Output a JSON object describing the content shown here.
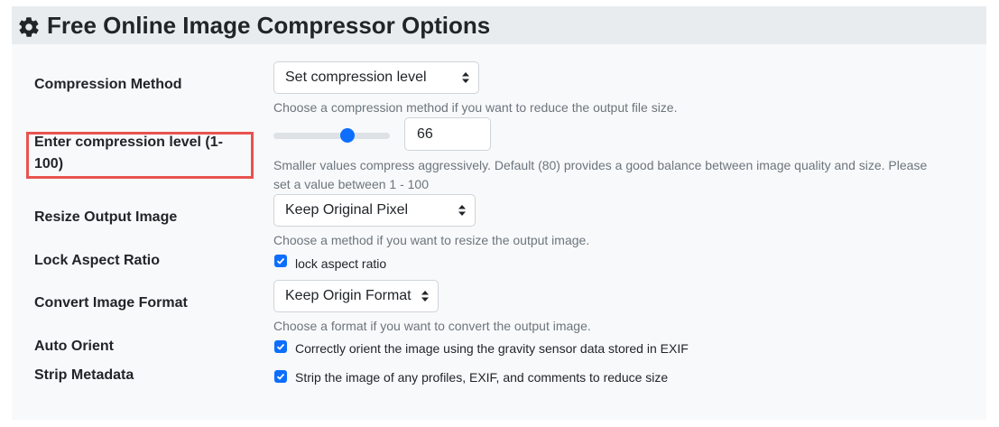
{
  "header": {
    "title": "Free Online Image Compressor Options",
    "icon": "gear-icon"
  },
  "compression_method": {
    "label": "Compression Method",
    "selected": "Set compression level",
    "help": "Choose a compression method if you want to reduce the output file size."
  },
  "compression_level": {
    "label_line1": "Enter compression level (1-",
    "label_line2": "100)",
    "value": "66",
    "slider_min": 1,
    "slider_max": 100,
    "slider_value": 66,
    "help_line1": "Smaller values compress aggressively. Default (80) provides a good balance between image quality and size. Please",
    "help_line2": "set a value between 1 - 100"
  },
  "resize": {
    "label": "Resize Output Image",
    "selected": "Keep Original Pixel",
    "help": "Choose a method if you want to resize the output image."
  },
  "lock_aspect": {
    "label": "Lock Aspect Ratio",
    "checkbox_label": "lock aspect ratio",
    "checked": true
  },
  "convert_format": {
    "label": "Convert Image Format",
    "selected": "Keep Origin Format",
    "help": "Choose a format if you want to convert the output image."
  },
  "auto_orient": {
    "label": "Auto Orient",
    "checkbox_label": "Correctly orient the image using the gravity sensor data stored in EXIF",
    "checked": true
  },
  "strip_metadata": {
    "label": "Strip Metadata",
    "checkbox_label": "Strip the image of any profiles, EXIF, and comments to reduce size",
    "checked": true
  },
  "colors": {
    "accent": "#0d6efd",
    "highlight": "#e8534f",
    "header_bg": "#e9ecef",
    "panel_bg": "#f8f9fa"
  }
}
